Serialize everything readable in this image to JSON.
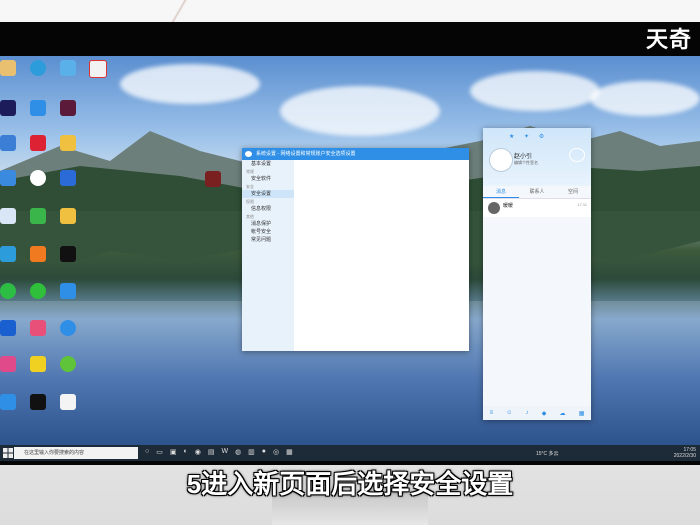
{
  "watermark": "天奇",
  "subtitle": "5进入新页面后选择安全设置",
  "settings_window": {
    "title": "系统设置 - 网络设置和常规账户安全选项设置",
    "sidebar": [
      {
        "type": "item",
        "label": "基本设置"
      },
      {
        "type": "head",
        "label": "常规"
      },
      {
        "type": "item",
        "label": "安全软件"
      },
      {
        "type": "head",
        "label": "安全"
      },
      {
        "type": "item",
        "label": "安全设置",
        "active": true
      },
      {
        "type": "head",
        "label": "权限"
      },
      {
        "type": "item",
        "label": "信息权限"
      },
      {
        "type": "head",
        "label": "其他"
      },
      {
        "type": "item",
        "label": "消息保护"
      },
      {
        "type": "item",
        "label": "帐号安全"
      },
      {
        "type": "item",
        "label": "常见问题"
      }
    ]
  },
  "qq_window": {
    "name": "赵小引",
    "signature": "编辑个性签名",
    "tabs": [
      "消息",
      "联系人",
      "空间"
    ],
    "chats": [
      {
        "name": "暖暖",
        "time": "17:11"
      }
    ]
  },
  "taskbar": {
    "search_placeholder": "在这里输入你要搜索的内容",
    "weather": "15°C 多云",
    "time": "17:05",
    "date": "2022/2/30"
  },
  "colors": {
    "accent": "#2f8fe6",
    "taskbar": "#1d2b38"
  }
}
